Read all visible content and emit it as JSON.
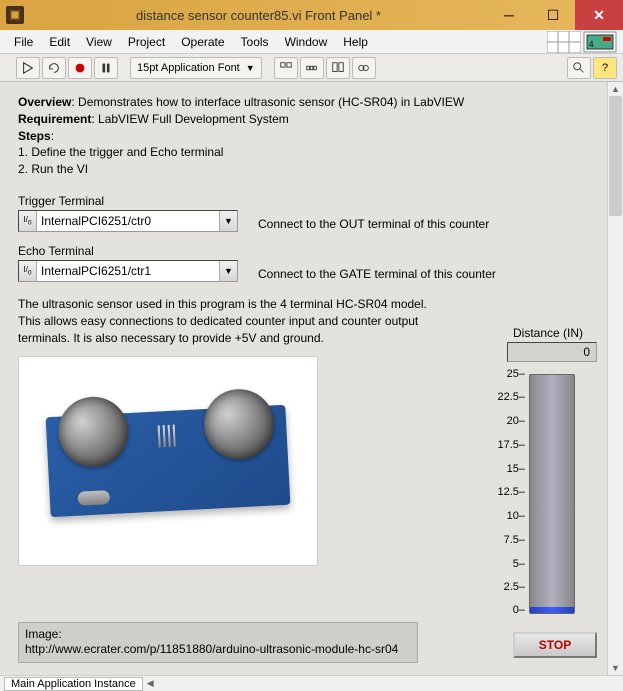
{
  "window": {
    "title": "distance sensor counter85.vi Front Panel *"
  },
  "menu": {
    "items": [
      "File",
      "Edit",
      "View",
      "Project",
      "Operate",
      "Tools",
      "Window",
      "Help"
    ]
  },
  "toolbar": {
    "font": "15pt Application Font"
  },
  "overview": {
    "label": "Overview",
    "text": ": Demonstrates how to interface ultrasonic sensor (HC-SR04) in LabVIEW"
  },
  "requirement": {
    "label": "Requirement",
    "text": ": LabVIEW Full Development System"
  },
  "steps": {
    "label": "Steps",
    "items": [
      "1. Define the trigger and Echo terminal",
      "2. Run the VI"
    ]
  },
  "trigger": {
    "label": "Trigger Terminal",
    "value": "InternalPCI6251/ctr0",
    "hint": "Connect to the OUT terminal of this counter"
  },
  "echo": {
    "label": "Echo Terminal",
    "value": "InternalPCI6251/ctr1",
    "hint": "Connect to the GATE terminal of this counter"
  },
  "distance": {
    "label": "Distance (IN)",
    "value": "0"
  },
  "description": "The ultrasonic sensor used in this program is the 4 terminal HC-SR04 model. This allows easy connections to dedicated counter input and counter output terminals.  It is also necessary to provide +5V and ground.",
  "image_src": {
    "label": "Image:",
    "url": "http://www.ecrater.com/p/11851880/arduino-ultrasonic-module-hc-sr04"
  },
  "stop": "STOP",
  "status": {
    "instance": "Main Application Instance"
  },
  "chart_data": {
    "type": "bar",
    "title": "Distance (IN)",
    "ylim": [
      0,
      25
    ],
    "ticks": [
      25,
      22.5,
      20,
      17.5,
      15,
      12.5,
      10,
      7.5,
      5,
      2.5,
      0
    ],
    "value": 0
  }
}
